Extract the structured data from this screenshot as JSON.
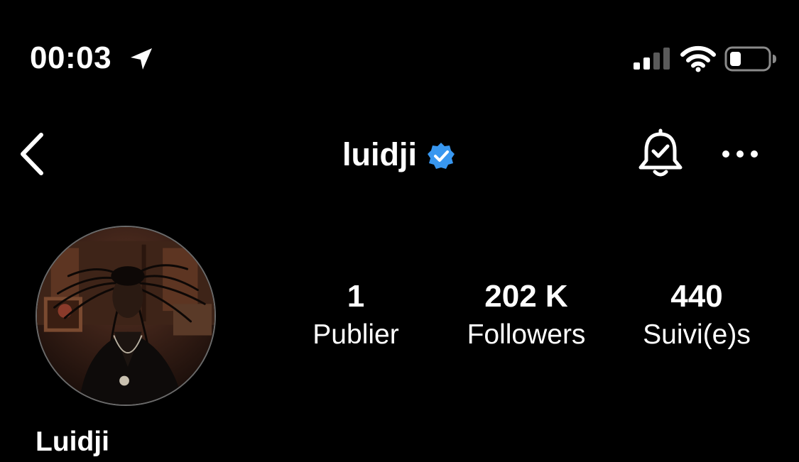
{
  "status_bar": {
    "time": "00:03",
    "location_icon": "location-arrow-icon",
    "signal_icon": "cellular-signal-icon",
    "wifi_icon": "wifi-icon",
    "battery_icon": "battery-icon",
    "battery_level": 0.2
  },
  "header": {
    "back_icon": "chevron-left-icon",
    "username": "luidji",
    "verified_icon": "verified-badge-icon",
    "verified_color": "#3897f0",
    "notifications_icon": "bell-check-icon",
    "more_icon": "more-horizontal-icon"
  },
  "profile": {
    "avatar_icon": "profile-avatar",
    "display_name": "Luidji",
    "stats": {
      "posts": {
        "value": "1",
        "label": "Publier"
      },
      "followers": {
        "value": "202 K",
        "label": "Followers"
      },
      "following": {
        "value": "440",
        "label": "Suivi(e)s"
      }
    }
  }
}
